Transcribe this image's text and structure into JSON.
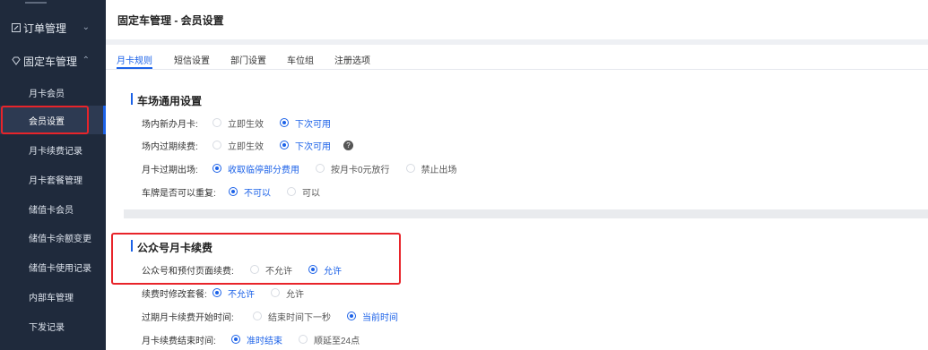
{
  "sidebar": {
    "groups": [
      {
        "label": "订单管理",
        "icon": "edit-icon",
        "chevron": "⌄"
      },
      {
        "label": "固定车管理",
        "icon": "diamond-icon",
        "chevron": "⌃"
      }
    ],
    "items": [
      {
        "label": "月卡会员"
      },
      {
        "label": "会员设置"
      },
      {
        "label": "月卡续费记录"
      },
      {
        "label": "月卡套餐管理"
      },
      {
        "label": "储值卡会员"
      },
      {
        "label": "储值卡余额变更"
      },
      {
        "label": "储值卡使用记录"
      },
      {
        "label": "内部车管理"
      },
      {
        "label": "下发记录"
      }
    ]
  },
  "page": {
    "title": "固定车管理 - 会员设置"
  },
  "tabs": [
    "月卡规则",
    "短信设置",
    "部门设置",
    "车位组",
    "注册选项"
  ],
  "section1": {
    "title": "车场通用设置",
    "rows": [
      {
        "label": "场内新办月卡:",
        "options": [
          "立即生效",
          "下次可用"
        ],
        "selected": 1
      },
      {
        "label": "场内过期续费:",
        "options": [
          "立即生效",
          "下次可用"
        ],
        "selected": 1
      },
      {
        "label": "月卡过期出场:",
        "options": [
          "收取临停部分费用",
          "按月卡0元放行",
          "禁止出场"
        ],
        "selected": 0
      },
      {
        "label": "车牌是否可以重复:",
        "options": [
          "不可以",
          "可以"
        ],
        "selected": 0
      }
    ]
  },
  "section2": {
    "title": "公众号月卡续费",
    "rows": [
      {
        "label": "公众号和预付页面续费:",
        "options": [
          "不允许",
          "允许"
        ],
        "selected": 1
      },
      {
        "label": "续费时修改套餐:",
        "options": [
          "不允许",
          "允许"
        ],
        "selected": 0
      },
      {
        "label": "过期月卡续费开始时间:",
        "options": [
          "结束时间下一秒",
          "当前时间"
        ],
        "selected": 1
      },
      {
        "label": "月卡续费结束时间:",
        "options": [
          "准时结束",
          "顺延至24点"
        ],
        "selected": 0
      }
    ]
  },
  "colors": {
    "sidebar_bg": "#1f2a3c",
    "accent": "#1c62e8",
    "highlight_border": "#e8242a"
  }
}
